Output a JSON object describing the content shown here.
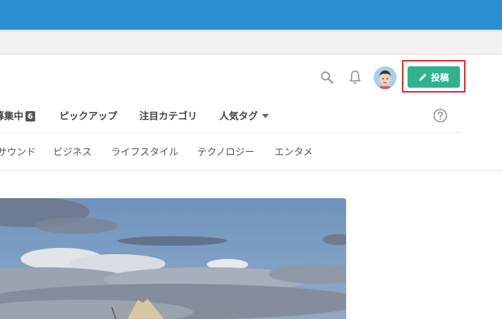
{
  "header": {
    "post_button_label": "投稿",
    "icons": {
      "search": "search-icon",
      "notifications": "bell-icon",
      "post": "pencil-icon",
      "help": "question-circle-icon"
    },
    "accent_color": "#2fb38f",
    "brand_color": "#2a8fd1"
  },
  "nav_primary": {
    "items": [
      {
        "label": "募集中",
        "badge": "6"
      },
      {
        "label": "ピックアップ"
      },
      {
        "label": "注目カテゴリ"
      },
      {
        "label": "人気タグ"
      }
    ]
  },
  "nav_secondary": {
    "items": [
      {
        "label": "サウンド"
      },
      {
        "label": "ビジネス"
      },
      {
        "label": "ライフスタイル"
      },
      {
        "label": "テクノロジー"
      },
      {
        "label": "エンタメ"
      }
    ]
  }
}
